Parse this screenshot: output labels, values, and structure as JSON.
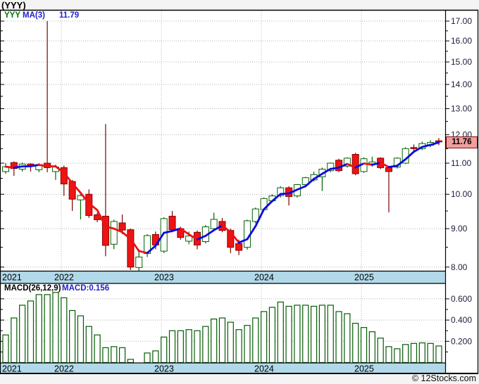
{
  "header": {
    "title": "(YYY)"
  },
  "price_panel": {
    "legend": {
      "symbol": "YYY",
      "ma_label": "MA(3)",
      "ma_value": "11.79"
    },
    "marker": {
      "label": "11.76"
    }
  },
  "macd_panel": {
    "legend": {
      "label": "MACD(26,12,9)",
      "value": "MACD:0.156"
    }
  },
  "footer": {
    "copyright": "© 12Stocks.com"
  },
  "colors": {
    "page_bg": "#f4f4f4",
    "plot_bg": "#ffffff",
    "band_bg": "#b2d9e9",
    "frame": "#000000",
    "grid": "#b4b4b4",
    "axis_text": "#1c1c3c",
    "year_text": "#000000",
    "candle_up_stroke": "#046404",
    "candle_up_fill": "#ffffff",
    "candle_down_fill": "#ee1414",
    "candle_down_stroke": "#8b0000",
    "wick_up": "#046404",
    "wick_down": "#7a0505",
    "ma_up": "#0a0ae0",
    "ma_down": "#ee1111",
    "macd_bar_stroke": "#055b05",
    "macd_bar_fill": "#ffffff",
    "legend_symbol": "#007700",
    "legend_blue": "#2222cc",
    "legend_black": "#000000",
    "marker_bg": "#f09e9e",
    "marker_border": "#7b1010",
    "marker_text": "#000000"
  },
  "chart_data": {
    "type": "candlestick",
    "symbol": "YYY",
    "title": "(YYY)",
    "overlay_ma": {
      "name": "MA(3)",
      "period": 3,
      "last_value": 11.79
    },
    "x_axis": {
      "years": [
        "2021",
        "2022",
        "2023",
        "2024",
        "2025"
      ],
      "year_gridline_x": [
        87,
        229,
        371,
        513
      ]
    },
    "price_axis": {
      "scale": "log",
      "tick_values": [
        8,
        9,
        10,
        11,
        12,
        13,
        14,
        15,
        16,
        17
      ],
      "tick_labels": [
        "8.00",
        "9.00",
        "10.00",
        "11.00",
        "12.00",
        "13.00",
        "14.00",
        "15.00",
        "16.00",
        "17.00"
      ],
      "minor_step": 0.5,
      "range": [
        7.9,
        17.35
      ],
      "last_price": 11.76
    },
    "candles_ohlc": [
      [
        10.72,
        11.0,
        10.65,
        10.88
      ],
      [
        11.02,
        11.06,
        10.58,
        10.82
      ],
      [
        10.8,
        11.02,
        10.72,
        10.97
      ],
      [
        10.97,
        11.0,
        10.72,
        10.9
      ],
      [
        10.78,
        11.0,
        10.7,
        10.95
      ],
      [
        11.0,
        17.0,
        10.7,
        10.85
      ],
      [
        10.72,
        10.95,
        10.45,
        10.87
      ],
      [
        10.85,
        10.92,
        9.95,
        10.32
      ],
      [
        10.4,
        10.45,
        9.5,
        9.85
      ],
      [
        9.83,
        10.0,
        9.26,
        9.96
      ],
      [
        10.0,
        10.15,
        9.3,
        9.37
      ],
      [
        9.39,
        9.45,
        9.18,
        9.25
      ],
      [
        9.35,
        12.4,
        8.27,
        8.55
      ],
      [
        8.58,
        9.25,
        8.45,
        9.2
      ],
      [
        9.16,
        9.4,
        8.85,
        8.96
      ],
      [
        8.97,
        9.0,
        7.93,
        8.0
      ],
      [
        7.99,
        8.4,
        7.9,
        8.25
      ],
      [
        8.34,
        8.85,
        8.25,
        8.81
      ],
      [
        8.84,
        8.92,
        8.45,
        8.56
      ],
      [
        8.4,
        9.32,
        8.35,
        9.28
      ],
      [
        9.35,
        9.5,
        8.9,
        8.97
      ],
      [
        9.0,
        9.05,
        8.7,
        8.76
      ],
      [
        8.66,
        8.92,
        8.58,
        8.8
      ],
      [
        8.9,
        8.95,
        8.45,
        8.56
      ],
      [
        8.65,
        9.1,
        8.6,
        9.05
      ],
      [
        9.0,
        9.45,
        8.95,
        9.26
      ],
      [
        9.2,
        9.3,
        8.9,
        8.95
      ],
      [
        8.95,
        9.0,
        8.35,
        8.5
      ],
      [
        8.6,
        8.7,
        8.3,
        8.42
      ],
      [
        8.5,
        9.25,
        8.44,
        9.22
      ],
      [
        9.2,
        9.6,
        9.15,
        9.56
      ],
      [
        9.54,
        9.9,
        9.5,
        9.87
      ],
      [
        9.8,
        10.0,
        9.75,
        9.95
      ],
      [
        9.96,
        10.25,
        9.9,
        10.2
      ],
      [
        10.2,
        10.25,
        9.66,
        9.93
      ],
      [
        9.95,
        10.32,
        9.9,
        10.3
      ],
      [
        10.3,
        10.55,
        10.25,
        10.52
      ],
      [
        10.45,
        10.72,
        10.4,
        10.62
      ],
      [
        10.55,
        10.85,
        10.1,
        10.8
      ],
      [
        10.75,
        11.02,
        10.7,
        11.0
      ],
      [
        11.1,
        11.15,
        10.7,
        10.75
      ],
      [
        10.9,
        11.2,
        10.85,
        11.17
      ],
      [
        11.3,
        11.35,
        10.6,
        10.65
      ],
      [
        10.72,
        11.2,
        10.68,
        11.15
      ],
      [
        10.98,
        11.22,
        10.88,
        11.04
      ],
      [
        11.17,
        11.2,
        10.8,
        10.85
      ],
      [
        10.85,
        10.9,
        9.46,
        10.72
      ],
      [
        10.87,
        11.2,
        10.82,
        11.17
      ],
      [
        11.0,
        11.55,
        10.97,
        11.5
      ],
      [
        11.54,
        11.65,
        11.38,
        11.5
      ],
      [
        11.5,
        11.75,
        11.45,
        11.68
      ],
      [
        11.62,
        11.8,
        11.55,
        11.72
      ],
      [
        11.78,
        11.88,
        11.62,
        11.76
      ]
    ],
    "macd": {
      "label": "MACD(26,12,9)",
      "last_value": 0.156,
      "axis_tick_values": [
        0.2,
        0.4,
        0.6
      ],
      "axis_tick_labels": [
        "0.200",
        "0.400",
        "0.600"
      ],
      "minor_step": 0.1,
      "values": [
        0.26,
        0.42,
        0.54,
        0.58,
        0.64,
        0.64,
        0.66,
        0.61,
        0.49,
        0.44,
        0.34,
        0.26,
        0.14,
        0.15,
        0.14,
        0.03,
        0.0,
        0.09,
        0.11,
        0.24,
        0.3,
        0.3,
        0.31,
        0.3,
        0.34,
        0.41,
        0.42,
        0.38,
        0.31,
        0.35,
        0.42,
        0.48,
        0.52,
        0.57,
        0.53,
        0.54,
        0.54,
        0.53,
        0.54,
        0.54,
        0.48,
        0.46,
        0.37,
        0.33,
        0.29,
        0.23,
        0.15,
        0.13,
        0.17,
        0.18,
        0.185,
        0.18,
        0.156
      ]
    }
  }
}
